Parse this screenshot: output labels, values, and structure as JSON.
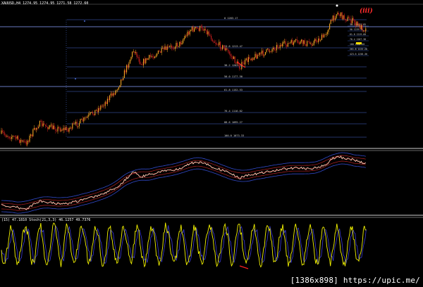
{
  "symbol_header": "XAUUSD,H4  1274.95 1274.95 1271.58 1272.60",
  "osc_header": "(15) 47.1810  Stoch(21,3,3) 46.1257 49.7376",
  "wave_label": "(iii)",
  "watermark": "[1386x898] https://upic.me/",
  "fib_levels": [
    {
      "label": "0  1283.17"
    },
    {
      "label": "23.6  1213.47"
    },
    {
      "label": "38.2  1202.38"
    },
    {
      "label": "50.0  1177.50"
    },
    {
      "label": "61.8  1152.53"
    },
    {
      "label": "76.4  1116.02"
    },
    {
      "label": "88.6  1095.27"
    },
    {
      "label": "100.0  1073.33"
    }
  ],
  "right_fib_labels": [
    "38.2 1239.85",
    "50 1229.36",
    "61.8 1219.60",
    "76.4 1207.38",
    "100 1188.60",
    "261.8 1225.28",
    "423.6 1258.36"
  ],
  "colors": {
    "bull": "#f5a623",
    "bear": "#c81e1e",
    "fib": "#4a6bd1",
    "hline": "#8aa0ff",
    "env_red": "#b22222",
    "env_blue": "#3049c8",
    "price_line": "#ffd9c0",
    "stoch_main": "#f2f200",
    "stoch_signal": "#3b3bd9",
    "arrow": "#ff2020"
  }
}
